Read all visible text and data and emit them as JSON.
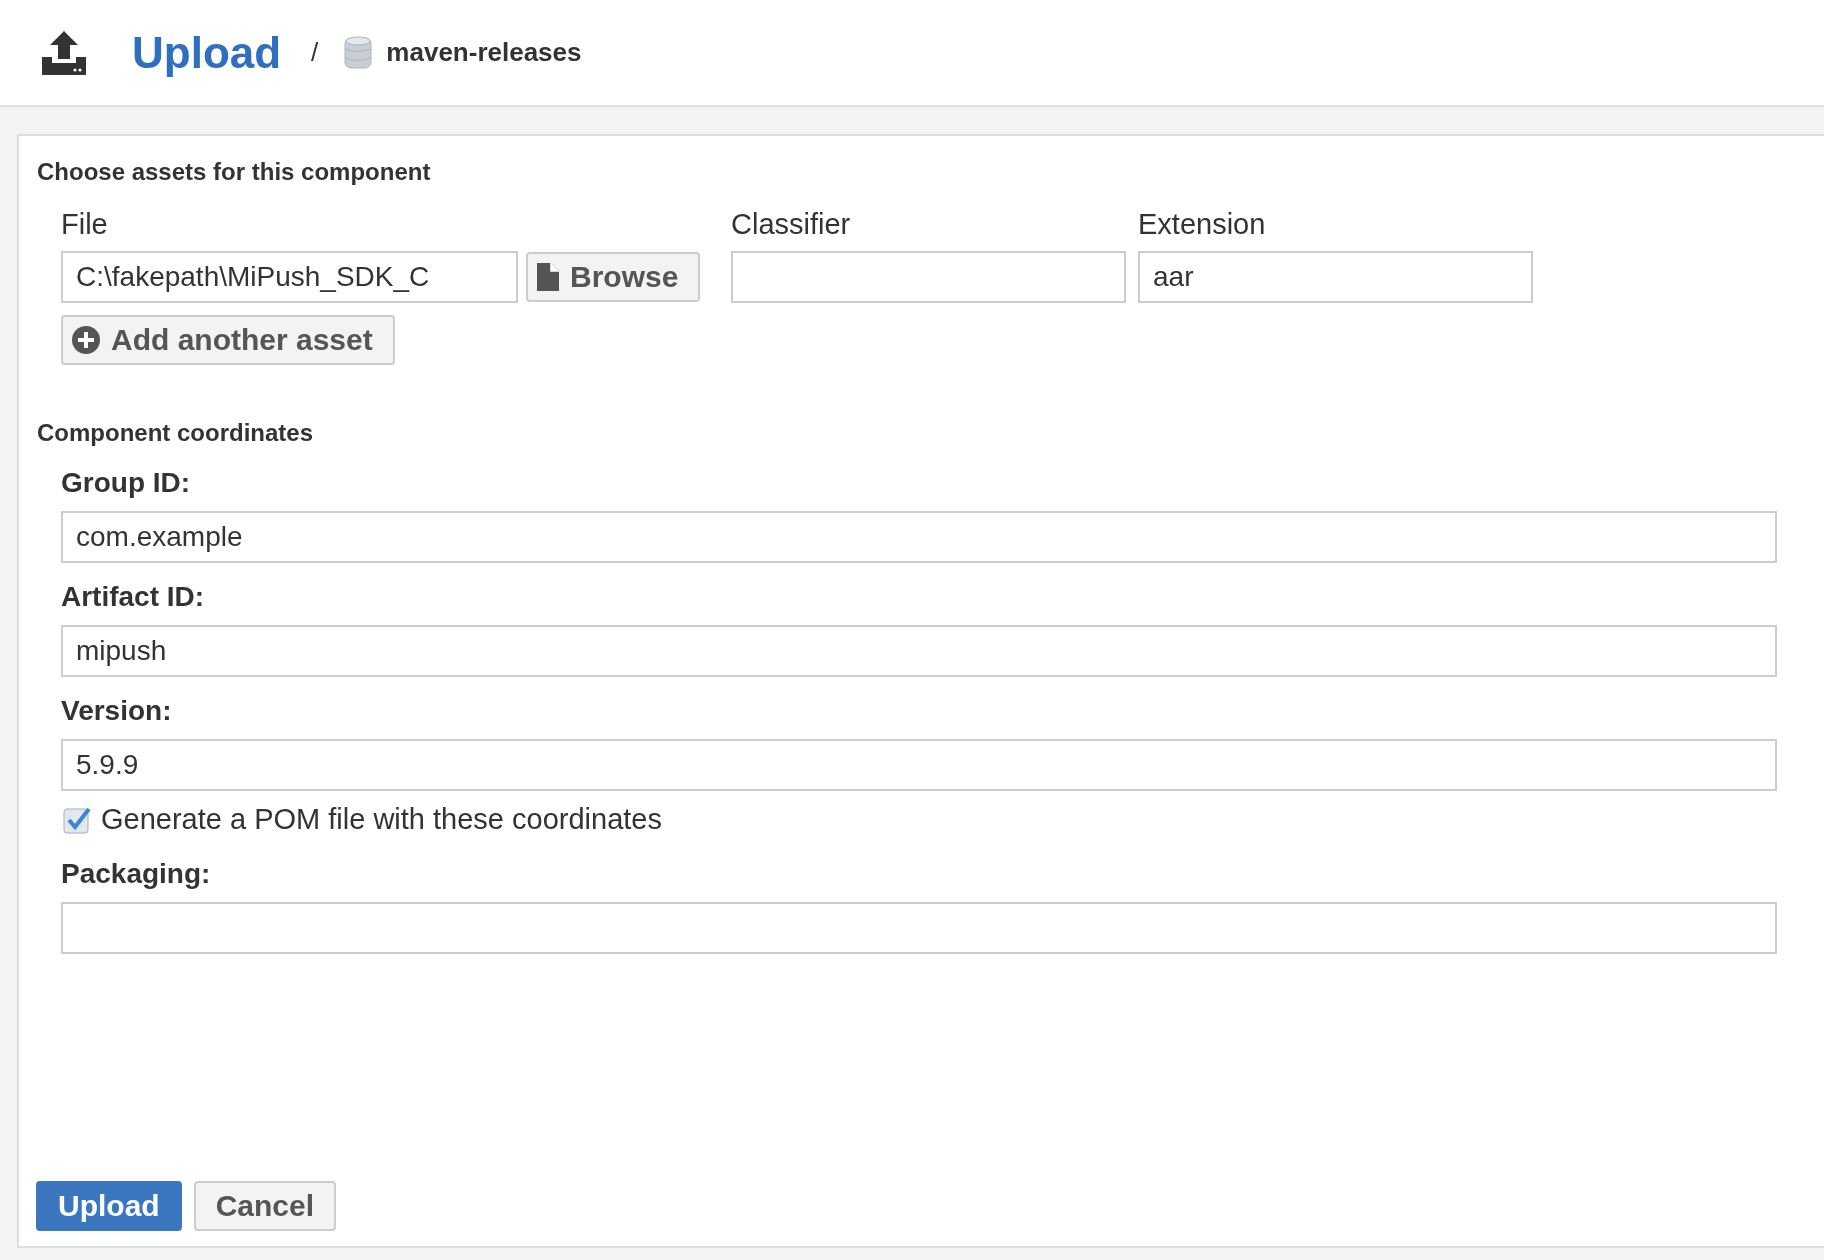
{
  "header": {
    "title": "Upload",
    "separator": "/",
    "repository": "maven-releases"
  },
  "assets": {
    "heading": "Choose assets for this component",
    "columns": [
      "File",
      "Classifier",
      "Extension"
    ],
    "rows": [
      {
        "file": "C:\\fakepath\\MiPush_SDK_C",
        "browse": "Browse",
        "extension": "aar"
      }
    ],
    "add_button": "Add another asset"
  },
  "coordinates": {
    "heading": "Component coordinates",
    "fields": [
      {
        "label": "Group ID:",
        "value": "com.example"
      },
      {
        "label": "Artifact ID:",
        "value": "mipush"
      },
      {
        "label": "Version:",
        "value": "5.9.9"
      }
    ],
    "generate_pom": {
      "label": "Generate a POM file with these coordinates",
      "checked": true
    },
    "packaging": {
      "label": "Packaging:"
    }
  },
  "actions": [
    {
      "label": "Upload",
      "kind": "primary"
    },
    {
      "label": "Cancel",
      "kind": "secondary"
    }
  ]
}
